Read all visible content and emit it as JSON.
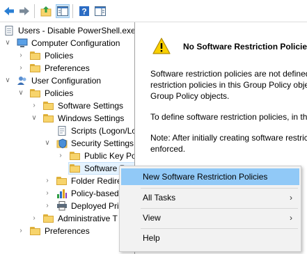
{
  "toolbar": {
    "buttons": [
      {
        "name": "back-button",
        "icon": "arrow-left-icon"
      },
      {
        "name": "forward-button",
        "icon": "arrow-right-icon"
      },
      {
        "name": "up-button",
        "icon": "up-folder-icon"
      },
      {
        "name": "show-hide-tree-button",
        "icon": "console-tree-icon"
      },
      {
        "name": "help-button",
        "icon": "help-icon"
      },
      {
        "name": "action-pane-button",
        "icon": "action-pane-icon"
      }
    ]
  },
  "tree": {
    "root": "Users - Disable PowerShell.exe [",
    "computer_configuration": "Computer Configuration",
    "cc_policies": "Policies",
    "cc_preferences": "Preferences",
    "user_configuration": "User Configuration",
    "uc_policies": "Policies",
    "software_settings": "Software Settings",
    "windows_settings": "Windows Settings",
    "scripts": "Scripts (Logon/Lo",
    "security_settings": "Security Settings",
    "public_key": "Public Key Po",
    "software_restriction": "Software R",
    "folder_redirection": "Folder Redire",
    "policy_based": "Policy-based",
    "deployed_printers": "Deployed Pri",
    "administrative": "Administrative T",
    "uc_preferences": "Preferences"
  },
  "pane": {
    "title": "No Software Restriction Policies",
    "para1": [
      "Software restriction policies are not defined",
      "restriction policies in this Group Policy obje",
      "Group Policy objects."
    ],
    "para2": "To define software restriction policies, in th",
    "para3": [
      "Note: After initially creating software restric",
      "enforced."
    ]
  },
  "context_menu": {
    "items": [
      {
        "label": "New Software Restriction Policies",
        "highlighted": true,
        "submenu": false
      },
      {
        "label": "All Tasks",
        "highlighted": false,
        "submenu": true
      },
      {
        "label": "View",
        "highlighted": false,
        "submenu": true
      },
      {
        "label": "Help",
        "highlighted": false,
        "submenu": false
      }
    ],
    "submenu_arrow": "›"
  },
  "colors": {
    "menu_highlight": "#91c9f7",
    "tree_selection": "#e5f3ff",
    "warning_yellow": "#f9d000"
  }
}
